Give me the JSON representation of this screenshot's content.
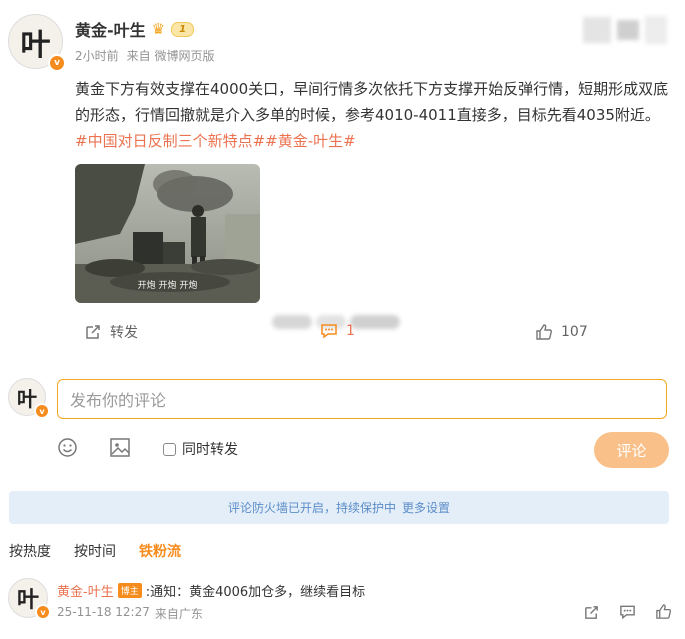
{
  "post": {
    "author": "黄金-叶生",
    "avatar_char": "叶",
    "level_badge": "1",
    "meta_time": "2小时前",
    "meta_source": "来自 微博网页版",
    "text_main": "黄金下方有效支撑在4000关口，早间行情多次依托下方支撑开始反弹行情，短期形成双底的形态，行情回撤就是介入多单的时候，参考4010-4011直接多，目标先看4035附近。",
    "text_tags": "#中国对日反制三个新特点##黄金-叶生#",
    "image_subtitle": "开炮 开炮 开炮",
    "actions": {
      "repost_label": "转发",
      "comment_count": "1",
      "like_count": "107"
    }
  },
  "composer": {
    "placeholder": "发布你的评论",
    "repost_checkbox_label": "同时转发",
    "submit_label": "评论"
  },
  "notice": {
    "text": "评论防火墙已开启，持续保护中",
    "link": "更多设置"
  },
  "sort_tabs": [
    "按热度",
    "按时间",
    "铁粉流"
  ],
  "comment": {
    "author": "黄金-叶生",
    "badge": "博主",
    "text": ":通知：黄金4006加仓多，继续看目标",
    "time": "25-11-18 12:27",
    "location": "来自广东"
  },
  "colors": {
    "accent": "#eb7350",
    "badge_orange": "#f78c1e",
    "notice_bg": "#e3eef9",
    "notice_text": "#5b8dc8",
    "submit_bg": "#f9c08a",
    "composer_border": "#f5a623"
  }
}
